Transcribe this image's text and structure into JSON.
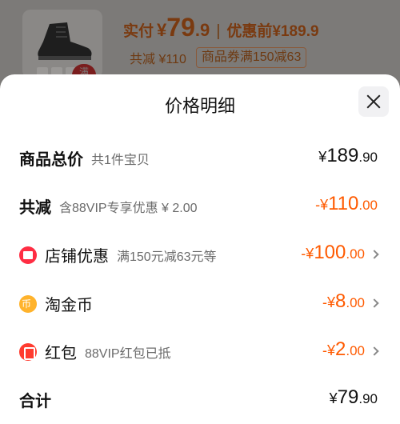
{
  "product": {
    "paid_label": "实付",
    "paid_yen": "¥",
    "paid_int": "79",
    "paid_dec": ".9",
    "separator": "|",
    "orig_text": "优惠前¥189.9",
    "total_discount_text": "共减 ¥110",
    "coupon_text": "商品券满150减63",
    "corner_tag": "满"
  },
  "sheet": {
    "title": "价格明细"
  },
  "rows": [
    {
      "label": "商品总价",
      "note": "共1件宝贝",
      "sign": "",
      "yen": "¥",
      "int": "189",
      "dec": ".90"
    },
    {
      "label": "共减",
      "note": "含88VIP专享优惠 ¥ 2.00",
      "sign": "-",
      "yen": "¥",
      "int": "110",
      "dec": ".00"
    },
    {
      "label": "店铺优惠",
      "note": "满150元减63元等",
      "sign": "-",
      "yen": "¥",
      "int": "100",
      "dec": ".00"
    },
    {
      "label": "淘金币",
      "note": "",
      "sign": "-",
      "yen": "¥",
      "int": "8",
      "dec": ".00"
    },
    {
      "label": "红包",
      "note": "88VIP红包已抵",
      "sign": "-",
      "yen": "¥",
      "int": "2",
      "dec": ".00"
    },
    {
      "label": "合计",
      "note": "",
      "sign": "",
      "yen": "¥",
      "int": "79",
      "dec": ".90"
    }
  ],
  "icons": {
    "shop": "shop-icon",
    "coin": "taojinbi-coin-icon",
    "redpacket": "red-packet-icon",
    "close": "close-icon"
  },
  "colors": {
    "discount": "#ff5a00",
    "text": "#111111",
    "note": "#6b6b6b"
  }
}
